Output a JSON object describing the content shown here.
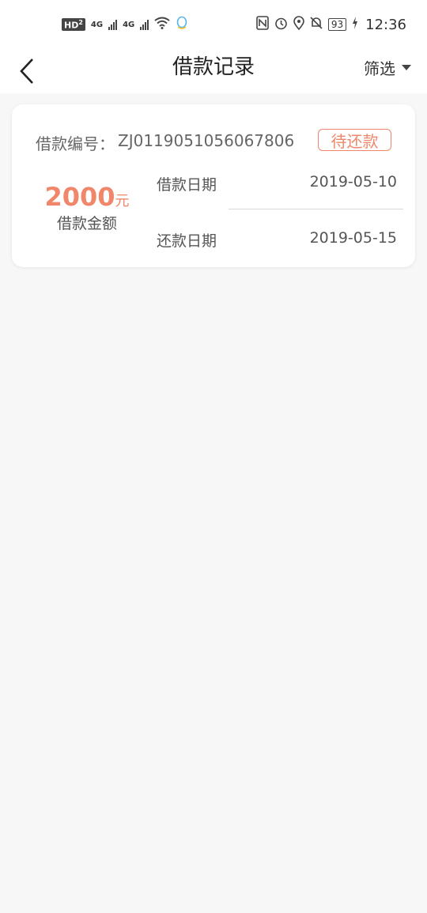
{
  "statusbar": {
    "hd": "HD",
    "hd_sub": "2",
    "net1": "4G",
    "net2": "4G",
    "battery": "93",
    "time": "12:36"
  },
  "nav": {
    "title": "借款记录",
    "filter_label": "筛选"
  },
  "loan": {
    "number_label": "借款编号：",
    "number": "ZJ0119051056067806",
    "status": "待还款",
    "amount": "2000",
    "amount_unit": "元",
    "amount_label": "借款金额",
    "loan_date_label": "借款日期",
    "loan_date": "2019-05-10",
    "repay_date_label": "还款日期",
    "repay_date": "2019-05-15"
  },
  "colors": {
    "accent": "#f0876a",
    "background": "#f7f7f7"
  }
}
